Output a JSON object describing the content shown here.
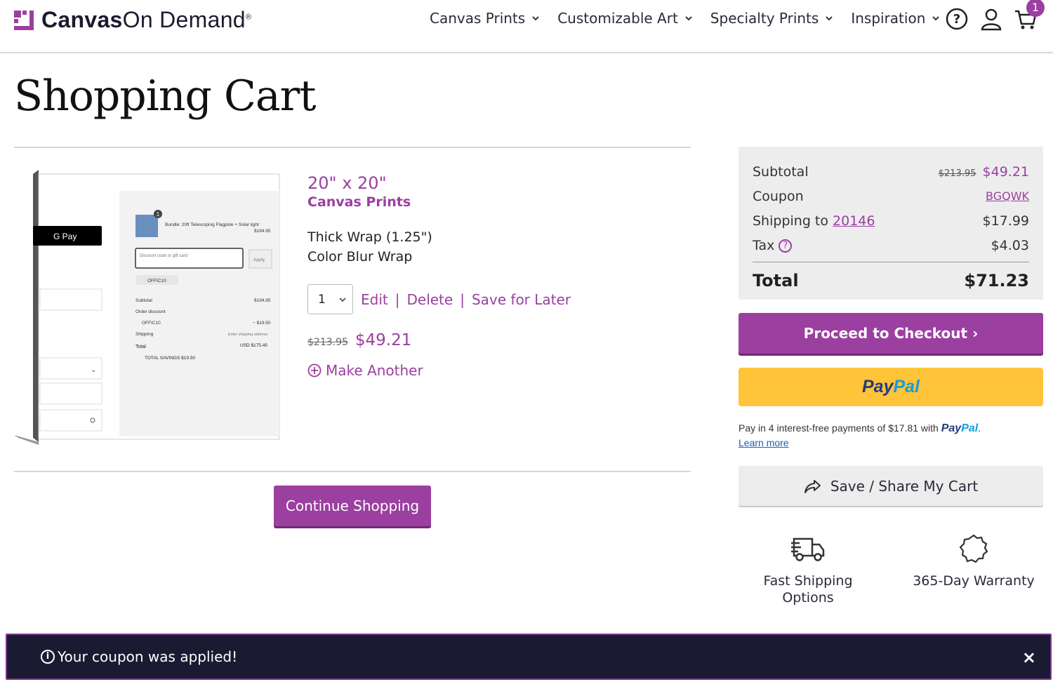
{
  "brand": {
    "name_bold": "Canvas",
    "name_light": "On Demand",
    "mark": "®",
    "color": "#9b3fa0"
  },
  "nav": {
    "items": [
      {
        "label": "Canvas Prints"
      },
      {
        "label": "Customizable Art"
      },
      {
        "label": "Specialty Prints"
      },
      {
        "label": "Inspiration"
      }
    ],
    "icons": [
      "help-icon",
      "account-icon",
      "cart-icon"
    ],
    "cart_count": "1"
  },
  "page": {
    "title": "Shopping Cart"
  },
  "item": {
    "size": "20\" x 20\"",
    "type": "Canvas Prints",
    "options": [
      "Thick Wrap (1.25\")",
      "Color Blur Wrap"
    ],
    "quantity": "1",
    "actions": {
      "edit": "Edit",
      "delete": "Delete",
      "save": "Save for Later"
    },
    "original_price": "$213.95",
    "price": "$49.21",
    "make_another": "Make Another",
    "thumbnail": {
      "gpay": "G Pay",
      "product_title": "Bundle: 20ft Telescoping Flagpole + Solar light",
      "product_price": "$194.95",
      "badge": "1",
      "discount_placeholder": "Discount code or gift card",
      "apply": "Apply",
      "code_tag": "OFFIC10",
      "rows": [
        {
          "label": "Subtotal",
          "value": "$194.95"
        },
        {
          "label": "Order discount",
          "value": ""
        },
        {
          "label": "OFFIC10",
          "value": "− $19.50"
        },
        {
          "label": "Shipping",
          "value": "Enter shipping address"
        },
        {
          "label": "Total",
          "value": "USD $175.45"
        }
      ],
      "savings": "TOTAL SAVINGS $19.50"
    }
  },
  "continue_label": "Continue Shopping",
  "summary": {
    "subtotal_label": "Subtotal",
    "subtotal_old": "$213.95",
    "subtotal": "$49.21",
    "coupon_label": "Coupon",
    "coupon_code": "BGQWK",
    "shipping_label": "Shipping to",
    "zip": "20146",
    "shipping": "$17.99",
    "tax_label": "Tax",
    "tax": "$4.03",
    "total_label": "Total",
    "total": "$71.23"
  },
  "checkout_label": "Proceed to Checkout ›",
  "paypal": {
    "word_a": "Pay",
    "word_b": "Pal",
    "note": "Pay in 4 interest-free payments of $17.81 with",
    "note_end": ".",
    "learn_more": "Learn more"
  },
  "share_label": "Save / Share My Cart",
  "features": [
    {
      "label": "Fast Shipping Options",
      "icon": "truck-icon"
    },
    {
      "label": "365-Day Warranty",
      "icon": "badge-icon"
    }
  ],
  "toast": {
    "message": "Your coupon was applied!",
    "close": "×"
  }
}
